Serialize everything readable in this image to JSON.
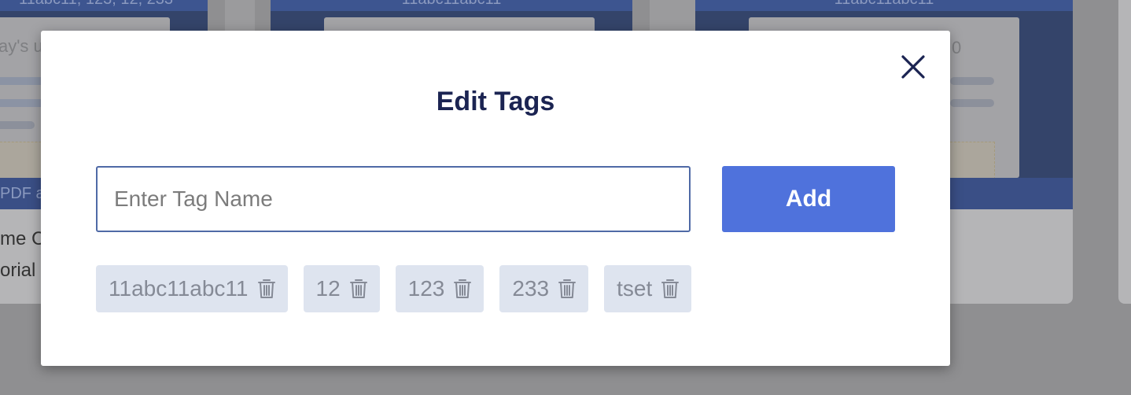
{
  "background": {
    "cards": [
      {
        "header": "11abc11, 123, 12, 233",
        "body_text": "ay's u",
        "footer": "PDF a",
        "line1": "me C",
        "line2": "orial"
      },
      {
        "header": "11abc11abc11"
      },
      {
        "header": "11abc11abc11",
        "partial_text": "0"
      }
    ]
  },
  "modal": {
    "title": "Edit Tags",
    "close_icon": "close-icon",
    "input": {
      "value": "",
      "placeholder": "Enter Tag Name"
    },
    "add_label": "Add",
    "tags": [
      {
        "label": "11abc11abc11"
      },
      {
        "label": "12"
      },
      {
        "label": "123"
      },
      {
        "label": "233"
      },
      {
        "label": "tset"
      }
    ]
  },
  "colors": {
    "title": "#1b2452",
    "accent": "#4f72dc",
    "chip_bg": "#dee4ef",
    "chip_text": "#858a96"
  }
}
